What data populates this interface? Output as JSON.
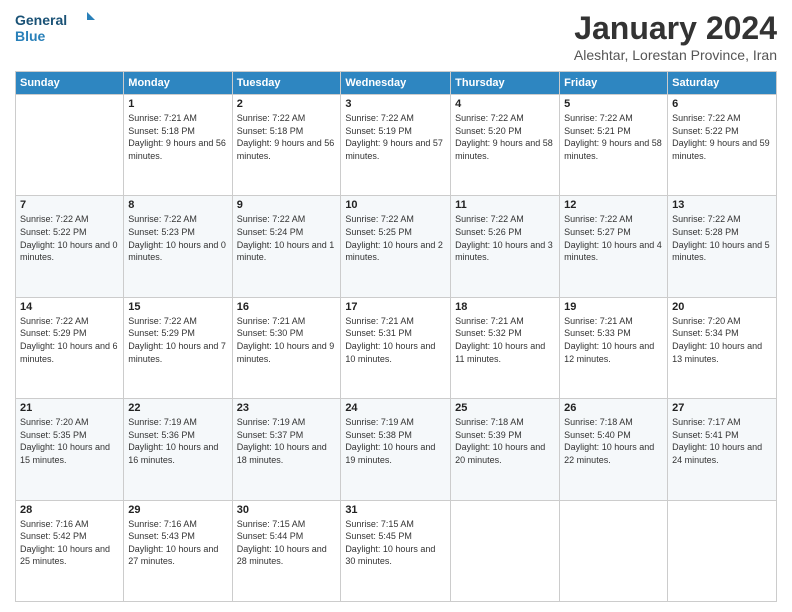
{
  "logo": {
    "line1": "General",
    "line2": "Blue"
  },
  "header": {
    "title": "January 2024",
    "subtitle": "Aleshtar, Lorestan Province, Iran"
  },
  "days_of_week": [
    "Sunday",
    "Monday",
    "Tuesday",
    "Wednesday",
    "Thursday",
    "Friday",
    "Saturday"
  ],
  "weeks": [
    [
      {
        "day": "",
        "sunrise": "",
        "sunset": "",
        "daylight": ""
      },
      {
        "day": "1",
        "sunrise": "Sunrise: 7:21 AM",
        "sunset": "Sunset: 5:18 PM",
        "daylight": "Daylight: 9 hours and 56 minutes."
      },
      {
        "day": "2",
        "sunrise": "Sunrise: 7:22 AM",
        "sunset": "Sunset: 5:18 PM",
        "daylight": "Daylight: 9 hours and 56 minutes."
      },
      {
        "day": "3",
        "sunrise": "Sunrise: 7:22 AM",
        "sunset": "Sunset: 5:19 PM",
        "daylight": "Daylight: 9 hours and 57 minutes."
      },
      {
        "day": "4",
        "sunrise": "Sunrise: 7:22 AM",
        "sunset": "Sunset: 5:20 PM",
        "daylight": "Daylight: 9 hours and 58 minutes."
      },
      {
        "day": "5",
        "sunrise": "Sunrise: 7:22 AM",
        "sunset": "Sunset: 5:21 PM",
        "daylight": "Daylight: 9 hours and 58 minutes."
      },
      {
        "day": "6",
        "sunrise": "Sunrise: 7:22 AM",
        "sunset": "Sunset: 5:22 PM",
        "daylight": "Daylight: 9 hours and 59 minutes."
      }
    ],
    [
      {
        "day": "7",
        "sunrise": "Sunrise: 7:22 AM",
        "sunset": "Sunset: 5:22 PM",
        "daylight": "Daylight: 10 hours and 0 minutes."
      },
      {
        "day": "8",
        "sunrise": "Sunrise: 7:22 AM",
        "sunset": "Sunset: 5:23 PM",
        "daylight": "Daylight: 10 hours and 0 minutes."
      },
      {
        "day": "9",
        "sunrise": "Sunrise: 7:22 AM",
        "sunset": "Sunset: 5:24 PM",
        "daylight": "Daylight: 10 hours and 1 minute."
      },
      {
        "day": "10",
        "sunrise": "Sunrise: 7:22 AM",
        "sunset": "Sunset: 5:25 PM",
        "daylight": "Daylight: 10 hours and 2 minutes."
      },
      {
        "day": "11",
        "sunrise": "Sunrise: 7:22 AM",
        "sunset": "Sunset: 5:26 PM",
        "daylight": "Daylight: 10 hours and 3 minutes."
      },
      {
        "day": "12",
        "sunrise": "Sunrise: 7:22 AM",
        "sunset": "Sunset: 5:27 PM",
        "daylight": "Daylight: 10 hours and 4 minutes."
      },
      {
        "day": "13",
        "sunrise": "Sunrise: 7:22 AM",
        "sunset": "Sunset: 5:28 PM",
        "daylight": "Daylight: 10 hours and 5 minutes."
      }
    ],
    [
      {
        "day": "14",
        "sunrise": "Sunrise: 7:22 AM",
        "sunset": "Sunset: 5:29 PM",
        "daylight": "Daylight: 10 hours and 6 minutes."
      },
      {
        "day": "15",
        "sunrise": "Sunrise: 7:22 AM",
        "sunset": "Sunset: 5:29 PM",
        "daylight": "Daylight: 10 hours and 7 minutes."
      },
      {
        "day": "16",
        "sunrise": "Sunrise: 7:21 AM",
        "sunset": "Sunset: 5:30 PM",
        "daylight": "Daylight: 10 hours and 9 minutes."
      },
      {
        "day": "17",
        "sunrise": "Sunrise: 7:21 AM",
        "sunset": "Sunset: 5:31 PM",
        "daylight": "Daylight: 10 hours and 10 minutes."
      },
      {
        "day": "18",
        "sunrise": "Sunrise: 7:21 AM",
        "sunset": "Sunset: 5:32 PM",
        "daylight": "Daylight: 10 hours and 11 minutes."
      },
      {
        "day": "19",
        "sunrise": "Sunrise: 7:21 AM",
        "sunset": "Sunset: 5:33 PM",
        "daylight": "Daylight: 10 hours and 12 minutes."
      },
      {
        "day": "20",
        "sunrise": "Sunrise: 7:20 AM",
        "sunset": "Sunset: 5:34 PM",
        "daylight": "Daylight: 10 hours and 13 minutes."
      }
    ],
    [
      {
        "day": "21",
        "sunrise": "Sunrise: 7:20 AM",
        "sunset": "Sunset: 5:35 PM",
        "daylight": "Daylight: 10 hours and 15 minutes."
      },
      {
        "day": "22",
        "sunrise": "Sunrise: 7:19 AM",
        "sunset": "Sunset: 5:36 PM",
        "daylight": "Daylight: 10 hours and 16 minutes."
      },
      {
        "day": "23",
        "sunrise": "Sunrise: 7:19 AM",
        "sunset": "Sunset: 5:37 PM",
        "daylight": "Daylight: 10 hours and 18 minutes."
      },
      {
        "day": "24",
        "sunrise": "Sunrise: 7:19 AM",
        "sunset": "Sunset: 5:38 PM",
        "daylight": "Daylight: 10 hours and 19 minutes."
      },
      {
        "day": "25",
        "sunrise": "Sunrise: 7:18 AM",
        "sunset": "Sunset: 5:39 PM",
        "daylight": "Daylight: 10 hours and 20 minutes."
      },
      {
        "day": "26",
        "sunrise": "Sunrise: 7:18 AM",
        "sunset": "Sunset: 5:40 PM",
        "daylight": "Daylight: 10 hours and 22 minutes."
      },
      {
        "day": "27",
        "sunrise": "Sunrise: 7:17 AM",
        "sunset": "Sunset: 5:41 PM",
        "daylight": "Daylight: 10 hours and 24 minutes."
      }
    ],
    [
      {
        "day": "28",
        "sunrise": "Sunrise: 7:16 AM",
        "sunset": "Sunset: 5:42 PM",
        "daylight": "Daylight: 10 hours and 25 minutes."
      },
      {
        "day": "29",
        "sunrise": "Sunrise: 7:16 AM",
        "sunset": "Sunset: 5:43 PM",
        "daylight": "Daylight: 10 hours and 27 minutes."
      },
      {
        "day": "30",
        "sunrise": "Sunrise: 7:15 AM",
        "sunset": "Sunset: 5:44 PM",
        "daylight": "Daylight: 10 hours and 28 minutes."
      },
      {
        "day": "31",
        "sunrise": "Sunrise: 7:15 AM",
        "sunset": "Sunset: 5:45 PM",
        "daylight": "Daylight: 10 hours and 30 minutes."
      },
      {
        "day": "",
        "sunrise": "",
        "sunset": "",
        "daylight": ""
      },
      {
        "day": "",
        "sunrise": "",
        "sunset": "",
        "daylight": ""
      },
      {
        "day": "",
        "sunrise": "",
        "sunset": "",
        "daylight": ""
      }
    ]
  ]
}
